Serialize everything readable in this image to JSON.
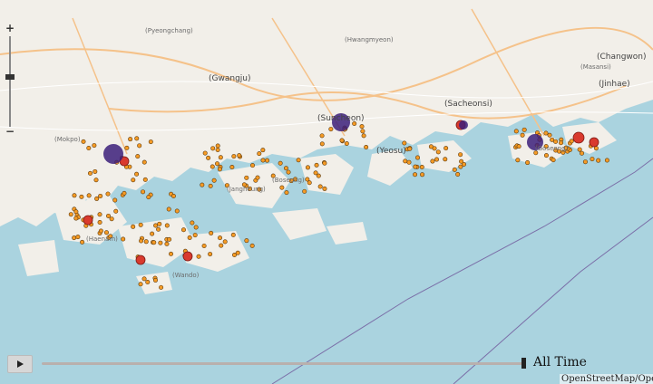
{
  "map": {
    "colors": {
      "sea": "#aad3df",
      "land": "#f2efe9",
      "road": "#f5c28a",
      "road_minor": "#ffffff",
      "border": "#7b6fa8",
      "marker_small": "#f59a24",
      "marker_red": "#d93a2e",
      "marker_purple": "#3c1f7a"
    },
    "place_labels": [
      "(Pyeongchang)",
      "(Hwangmyeon)",
      "(Gwangju)",
      "(Suncheon)",
      "(Sacheonsi)",
      "(Yeosu)",
      "(Changwon)",
      "(Jinhae)",
      "(Masansi)",
      "(Goseong)",
      "(Mokpo)",
      "(Haenam)",
      "(Wando)",
      "(Jangheung)",
      "(Boseong)"
    ]
  },
  "controls": {
    "zoom_in": "+",
    "zoom_out": "−",
    "zoom_level": 0.45,
    "play_icon": "play-icon",
    "time_label": "All Time",
    "time_position": 1.0
  },
  "attribution": "OpenStreetMap/Ope"
}
